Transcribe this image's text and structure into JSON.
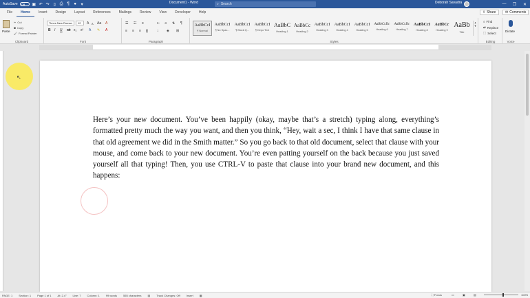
{
  "titlebar": {
    "autosave_label": "AutoSave",
    "autosave_state": "Off",
    "doc_title": "Document1 - Word",
    "search_placeholder": "Search",
    "user_name": "Deborah Savadra",
    "controls": {
      "minimize": "—",
      "restore": "❐",
      "close": "✕"
    }
  },
  "tabs": [
    "File",
    "Home",
    "Insert",
    "Design",
    "Layout",
    "References",
    "Mailings",
    "Review",
    "View",
    "Developer",
    "Help"
  ],
  "tab_actions": {
    "share": "Share",
    "comments": "Comments"
  },
  "ribbon": {
    "clipboard": {
      "paste": "Paste",
      "cut": "Cut",
      "copy": "Copy",
      "format_painter": "Format Painter",
      "label": "Clipboard"
    },
    "font": {
      "name": "Times New Roman",
      "size": "12",
      "bold": "B",
      "italic": "I",
      "underline": "U",
      "strike": "ab",
      "subscript": "x₂",
      "superscript": "x²",
      "text_effects": "A",
      "highlight": "✎",
      "font_color": "A",
      "grow": "A",
      "shrink": "A",
      "case": "Aa",
      "clear": "A",
      "label": "Font"
    },
    "paragraph": {
      "label": "Paragraph"
    },
    "styles": {
      "label": "Styles",
      "items": [
        {
          "sample": "AaBbCcI",
          "name": "¶ Normal"
        },
        {
          "sample": "AaBbCcI",
          "name": "¶ No Spac..."
        },
        {
          "sample": "AaBbCcI",
          "name": "¶ Block Q..."
        },
        {
          "sample": "AaBbCcI",
          "name": "¶ Depo Text"
        },
        {
          "sample": "AaBbC",
          "name": "Heading 1"
        },
        {
          "sample": "AaBbCc",
          "name": "Heading 2"
        },
        {
          "sample": "AaBbCcI",
          "name": "Heading 3"
        },
        {
          "sample": "AaBbCcI",
          "name": "Heading 4"
        },
        {
          "sample": "AaBbCcI",
          "name": "Heading 5"
        },
        {
          "sample": "AaBbCcDc",
          "name": "Heading 6"
        },
        {
          "sample": "AaBbCcDc",
          "name": "Heading 7"
        },
        {
          "sample": "AaBbCcI",
          "name": "Heading 8"
        },
        {
          "sample": "AaBbCc",
          "name": "Heading 9"
        },
        {
          "sample": "AaBb",
          "name": "Title"
        }
      ]
    },
    "editing": {
      "find": "Find",
      "replace": "Replace",
      "select": "Select",
      "label": "Editing"
    },
    "voice": {
      "dictate": "Dictate",
      "label": "Voice"
    }
  },
  "document": {
    "body": "Here’s your new document. You’ve been happily (okay, maybe that’s a stretch) typing along, everything’s formatted pretty much the way you want, and then you think, “Hey, wait a sec, I think I have that same clause in that old agreement we did in the Smith matter.” So you go back to that old document, select that clause with your mouse, and come back to your new document. You’re even patting yourself on the back because you just saved yourself all that typing! Then, you use CTRL-V to paste that clause into your brand new document, and this happens:"
  },
  "statusbar": {
    "page": "PAGE: 1",
    "section": "Section: 1",
    "page_of": "Page 1 of 1",
    "at": "At: 2.4\"",
    "line": "Line: 7",
    "column": "Column: 1",
    "words": "99 words",
    "characters": "555 characters",
    "track_changes": "Track Changes: Off",
    "insert": "Insert",
    "focus": "Focus",
    "zoom": "100%"
  },
  "colors": {
    "accent": "#2b579a",
    "cursor_halo": "#ffeb3c"
  }
}
